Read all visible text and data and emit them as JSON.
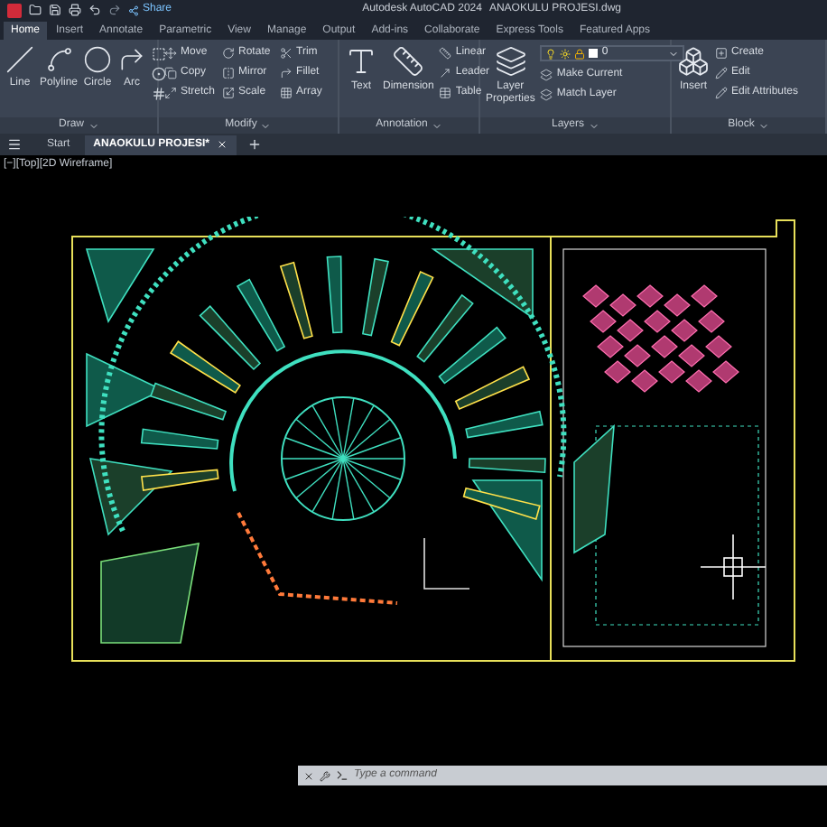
{
  "title_bar": {
    "quick_access": "Share",
    "app": "Autodesk AutoCAD 2024",
    "file": "ANAOKULU PROJESI.dwg"
  },
  "ribbon_tabs": [
    {
      "label": "Home",
      "selected": true
    },
    {
      "label": "Insert",
      "selected": false
    },
    {
      "label": "Annotate",
      "selected": false
    },
    {
      "label": "Parametric",
      "selected": false
    },
    {
      "label": "View",
      "selected": false
    },
    {
      "label": "Manage",
      "selected": false
    },
    {
      "label": "Output",
      "selected": false
    },
    {
      "label": "Add-ins",
      "selected": false
    },
    {
      "label": "Collaborate",
      "selected": false
    },
    {
      "label": "Express Tools",
      "selected": false
    },
    {
      "label": "Featured Apps",
      "selected": false
    }
  ],
  "panels": [
    {
      "title": "Draw",
      "large": [
        "Line",
        "Polyline",
        "Circle",
        "Arc"
      ]
    },
    {
      "title": "Modify",
      "small": [
        "Move",
        "Rotate",
        "Trim",
        "Copy",
        "Mirror",
        "Fillet",
        "Stretch",
        "Scale",
        "Array"
      ]
    },
    {
      "title": "Annotation",
      "large": [
        "Text",
        "Dimension"
      ],
      "small": [
        "Linear",
        "Leader",
        "Table"
      ]
    },
    {
      "title": "Layers",
      "large": [
        "Layer\nProperties"
      ],
      "layer": "0",
      "small": [
        "Make Current",
        "Match Layer"
      ]
    },
    {
      "title": "Block",
      "large": [
        "Insert"
      ],
      "small": [
        "Create",
        "Edit",
        "Edit Attributes"
      ]
    }
  ],
  "file_tabs": [
    {
      "label": "Start",
      "selected": false
    },
    {
      "label": "ANAOKULU PROJESI*",
      "selected": true
    }
  ],
  "viewport_label": "[−][Top][2D Wireframe]",
  "command_line": {
    "placeholder": "Type a command"
  }
}
